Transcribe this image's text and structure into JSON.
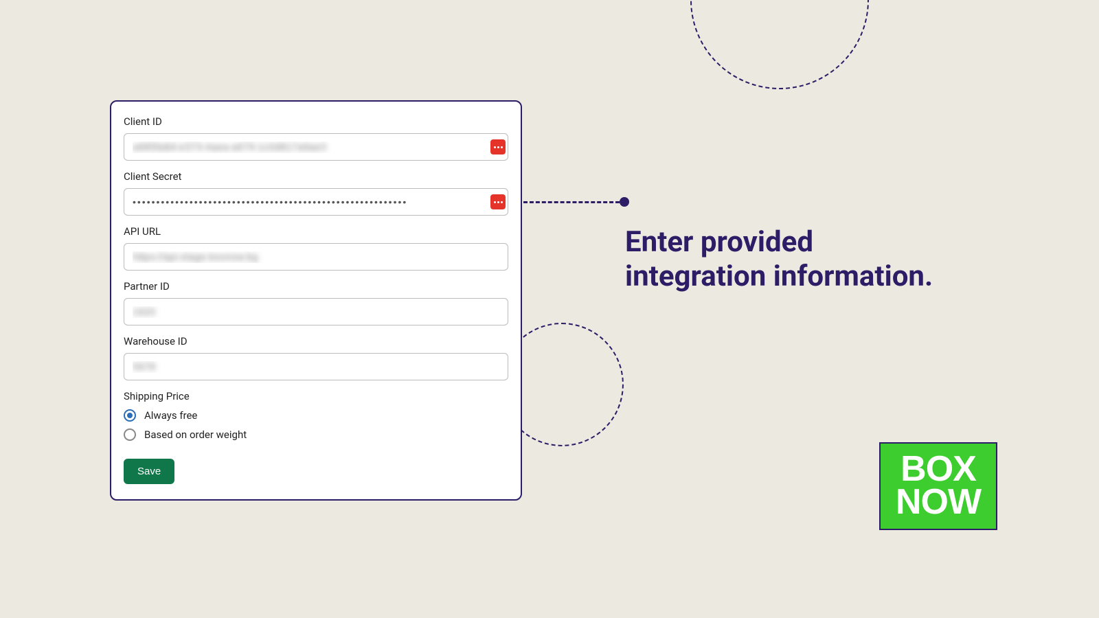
{
  "form": {
    "clientId": {
      "label": "Client ID",
      "value": "a685fa8d-e373-4aea-a679-1c0d817a9ae3"
    },
    "clientSecret": {
      "label": "Client Secret",
      "value": "••••••••••••••••••••••••••••••••••••••••••••••••••••••••••"
    },
    "apiUrl": {
      "label": "API URL",
      "value": "https://api-stage.boxnow.bg"
    },
    "partnerId": {
      "label": "Partner ID",
      "value": "1620"
    },
    "warehouseId": {
      "label": "Warehouse ID",
      "value": "5678"
    },
    "shippingPrice": {
      "label": "Shipping Price",
      "options": {
        "alwaysFree": "Always free",
        "basedOnWeight": "Based on order weight"
      },
      "selected": "alwaysFree"
    },
    "saveLabel": "Save"
  },
  "instruction": {
    "line1": "Enter provided",
    "line2": "integration information."
  },
  "logo": {
    "line1": "BOX",
    "line2": "NOW"
  }
}
